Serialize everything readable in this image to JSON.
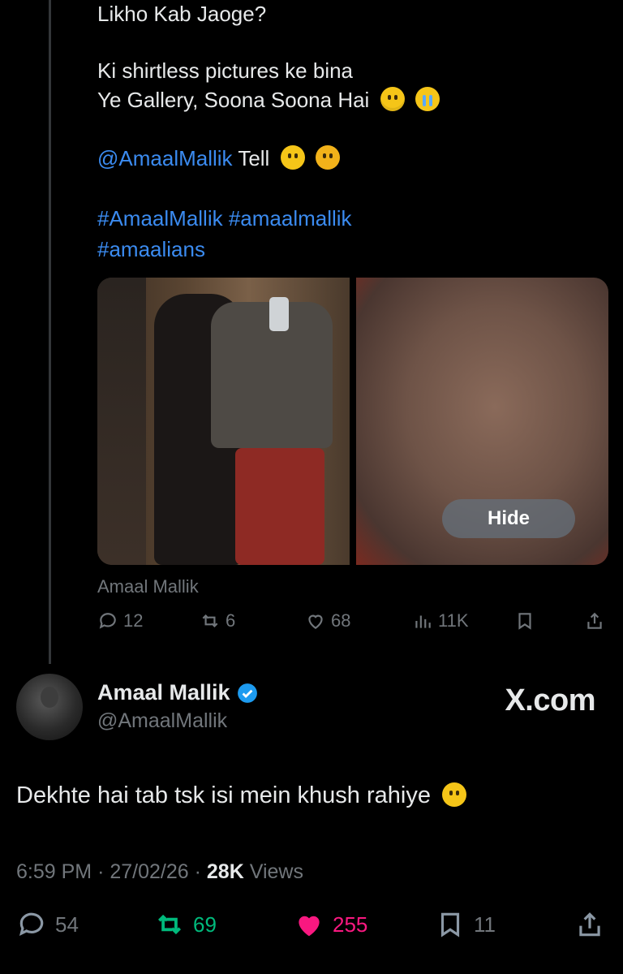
{
  "quoted_tweet": {
    "lines": [
      "Likho Kab Jaoge?",
      "Ki shirtless pictures ke bina",
      "Ye Gallery, Soona Soona Hai",
      "Tell",
      "#AmaalMallik #amaalmallik",
      "#amaalians"
    ],
    "mention": "@AmaalMallik",
    "media_hide_label": "Hide",
    "credit": "Amaal Mallik",
    "actions": {
      "replies": "12",
      "reposts": "6",
      "likes": "68",
      "views": "11K"
    }
  },
  "author": {
    "name": "Amaal Mallik",
    "handle": "@AmaalMallik",
    "watermark": "X.com"
  },
  "tweet": {
    "text": "Dekhte hai tab tsk isi mein khush rahiye",
    "time": "6:59 PM",
    "date": "27/02/26",
    "views_count": "28K",
    "views_label": "Views"
  },
  "actions": {
    "replies": "54",
    "reposts": "69",
    "likes": "255",
    "bookmarks": "11"
  },
  "colors": {
    "link": "#3b8bf0",
    "repost": "#00ba7c",
    "like": "#f91880",
    "muted": "#71767b"
  }
}
